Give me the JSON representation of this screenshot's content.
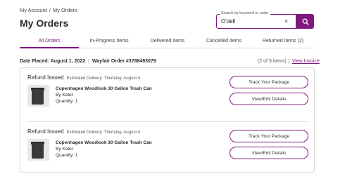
{
  "breadcrumb": {
    "items": [
      "My Account",
      "My Orders"
    ],
    "separator": "/"
  },
  "page_title": "My Orders",
  "search": {
    "legend": "Search by keyword or order",
    "value": "O'dell",
    "clear_glyph": "×"
  },
  "tabs": [
    {
      "label": "All Orders",
      "active": true
    },
    {
      "label": "In-Progress Items",
      "active": false
    },
    {
      "label": "Delivered Items",
      "active": false
    },
    {
      "label": "Cancelled Items",
      "active": false
    },
    {
      "label": "Returned Items (2)",
      "active": false
    }
  ],
  "order": {
    "date_placed": "Date Placed: August 1, 2022",
    "divider": "|",
    "order_number": "Wayfair Order #3788493079",
    "item_count": "(2 of 5 items)",
    "count_divider": "|",
    "view_invoice": "View Invoice"
  },
  "shipments": [
    {
      "status": "Refund Issued",
      "estimated": "Estimated Delivery: Thursday, August 4",
      "product_name": "Copenhagen Woodlook 30 Gallon Trash Can",
      "brand": "By Keter",
      "quantity": "Quantity: 1",
      "track_label": "Track Your Package",
      "details_label": "View/Edit Details"
    },
    {
      "status": "Refund Issued",
      "estimated": "Estimated Delivery: Thursday, August 4",
      "product_name": "Copenhagen Woodlook 30 Gallon Trash Can",
      "brand": "By Keter",
      "quantity": "Quantity: 1",
      "track_label": "Track Your Package",
      "details_label": "View/Edit Details"
    }
  ],
  "colors": {
    "accent": "#7f187f",
    "border": "#d9d9d9",
    "text": "#2b2b2b"
  },
  "icons": {
    "search_button": "search-icon",
    "product_image": "trash-can-photo"
  }
}
